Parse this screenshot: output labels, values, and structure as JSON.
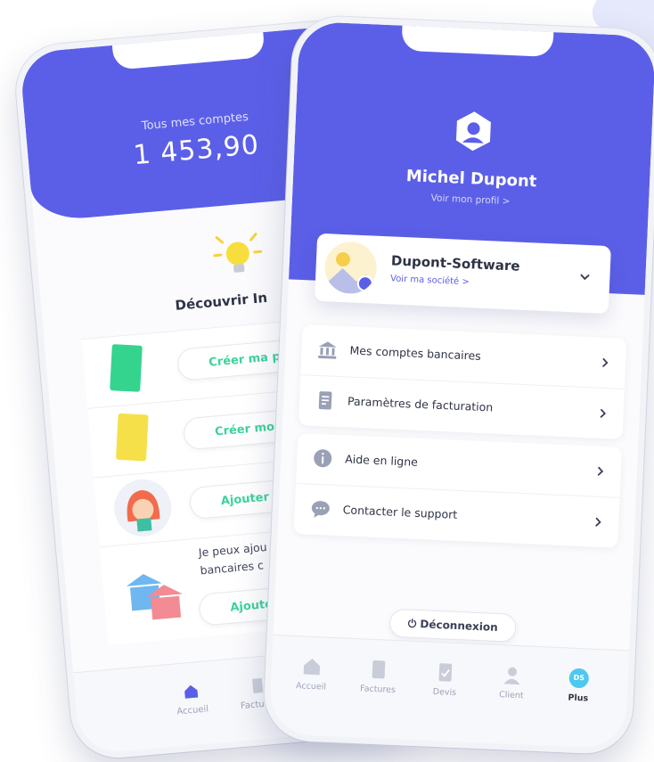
{
  "back_phone": {
    "header_caption": "Tous mes comptes",
    "balance": "1 453,90",
    "discover_title": "Découvrir In",
    "actions": [
      {
        "label": "Créer ma pro",
        "icon": "green-document-icon"
      },
      {
        "label": "Créer mon",
        "icon": "yellow-document-icon"
      },
      {
        "label": "Ajouter m",
        "icon": "client-face-icon"
      },
      {
        "label": "Ajouter",
        "icon": "bank-buildings-icon"
      }
    ],
    "bank_text_line1": "Je peux ajou",
    "bank_text_line2": "bancaires c",
    "tabs": [
      {
        "label": "Accueil",
        "icon": "home-icon"
      },
      {
        "label": "Factures",
        "icon": "invoice-icon"
      }
    ]
  },
  "front_phone": {
    "user_name": "Michel Dupont",
    "profile_link": "Voir mon profil >",
    "company": {
      "name": "Dupont-Software",
      "link": "Voir ma société >"
    },
    "menu_group_1": [
      {
        "label": "Mes comptes bancaires",
        "icon": "bank-icon"
      },
      {
        "label": "Paramètres de facturation",
        "icon": "billing-document-icon"
      }
    ],
    "menu_group_2": [
      {
        "label": "Aide en ligne",
        "icon": "info-icon"
      },
      {
        "label": "Contacter le support",
        "icon": "chat-bubble-icon"
      }
    ],
    "logout_label": "Déconnexion",
    "tabs": [
      {
        "label": "Accueil",
        "icon": "home-icon"
      },
      {
        "label": "Factures",
        "icon": "invoice-icon"
      },
      {
        "label": "Devis",
        "icon": "quote-icon"
      },
      {
        "label": "Client",
        "icon": "client-icon"
      },
      {
        "label": "Plus",
        "icon": "avatar-badge",
        "badge": "DS"
      }
    ]
  },
  "colors": {
    "primary": "#5b5fe8",
    "accent_green": "#3dd39b",
    "badge_blue": "#4fc8ee"
  }
}
